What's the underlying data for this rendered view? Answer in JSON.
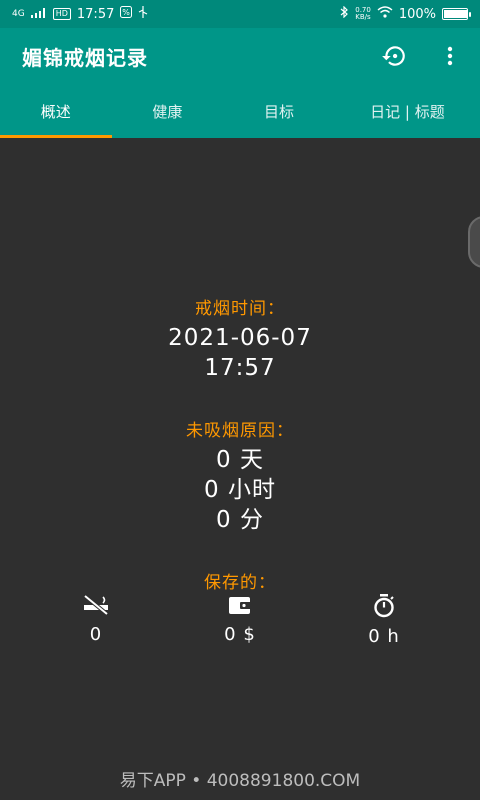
{
  "status_bar": {
    "network": "4G",
    "hd": "HD",
    "time": "17:57",
    "speed_value": "0.70",
    "speed_unit": "KB/s",
    "battery": "100%",
    "battery_level": 1.0
  },
  "app_bar": {
    "title": "媚锦戒烟记录",
    "actions": [
      {
        "name": "history-icon"
      },
      {
        "name": "more-vert-icon"
      }
    ]
  },
  "tabs": [
    {
      "label": "概述",
      "active": true
    },
    {
      "label": "健康",
      "active": false
    },
    {
      "label": "目标",
      "active": false
    },
    {
      "label": "日记 | 标题",
      "active": false
    }
  ],
  "quit_time": {
    "label": "戒烟时间：",
    "date": "2021-06-07",
    "time": "17:57"
  },
  "not_smoked": {
    "label": "未吸烟原因：",
    "days": "0 天",
    "hours": "0 小时",
    "minutes": "0 分"
  },
  "saved": {
    "label": "保存的：",
    "items": [
      {
        "icon": "no-smoking-icon",
        "value": "0"
      },
      {
        "icon": "wallet-icon",
        "value": "0 $"
      },
      {
        "icon": "stopwatch-icon",
        "value": "0 h"
      }
    ]
  },
  "watermark": "易下APP • 4008891800.COM",
  "colors": {
    "status_bar": "#00897b",
    "app_bar": "#009688",
    "accent": "#ff9800",
    "background": "#2f2f2f",
    "text": "#ffffff"
  }
}
